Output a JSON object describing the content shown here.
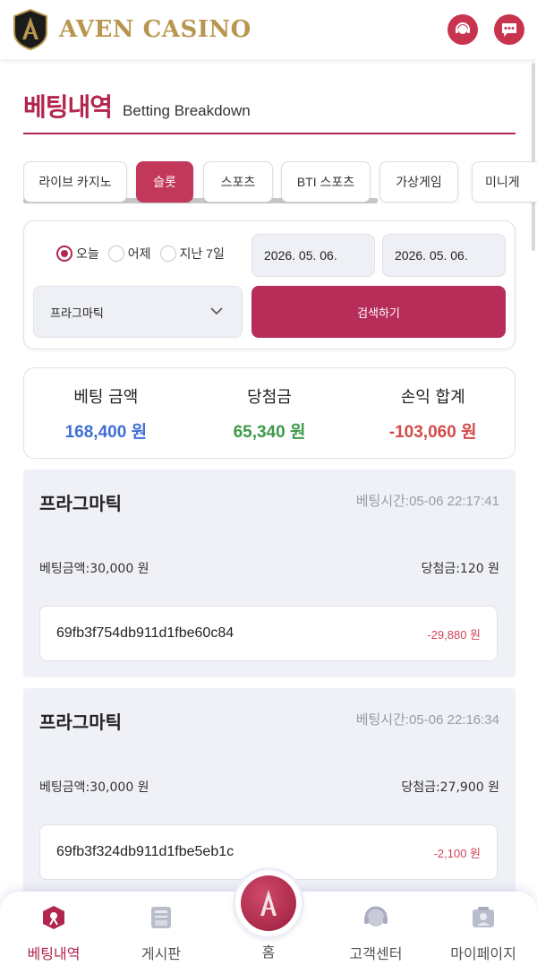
{
  "header": {
    "brand": "AVEN CASINO",
    "icons": [
      "aven-logo-icon",
      "support-agent-icon",
      "chat-bubble-icon"
    ],
    "accent": "#c8344d",
    "brand_color": "#b8964f"
  },
  "page": {
    "title": "베팅내역",
    "subtitle": "Betting Breakdown"
  },
  "tabs": [
    {
      "label": "라이브 카지노",
      "active": false
    },
    {
      "label": "슬롯",
      "active": true
    },
    {
      "label": "스포츠",
      "active": false
    },
    {
      "label": "BTI 스포츠",
      "active": false
    },
    {
      "label": "가상게임",
      "active": false
    },
    {
      "label": "미니게",
      "active": false
    }
  ],
  "filter": {
    "radios": [
      {
        "label": "오늘",
        "checked": true
      },
      {
        "label": "어제",
        "checked": false
      },
      {
        "label": "지난 7일",
        "checked": false
      }
    ],
    "date_from": "2026. 05. 06.",
    "date_to": "2026. 05. 06.",
    "provider": "프라그마틱",
    "search_label": "검색하기"
  },
  "summary": {
    "bet_label": "베팅 금액",
    "bet_value": "168,400 원",
    "win_label": "당첨금",
    "win_value": "65,340 원",
    "pl_label": "손익 합계",
    "pl_value": "-103,060 원",
    "colors": {
      "bet": "#3f6fd6",
      "win": "#3d9a4a",
      "pl": "#d34a4a"
    }
  },
  "records": [
    {
      "provider": "프라그마틱",
      "time": "베팅시간:05-06 22:17:41",
      "bet": "베팅금액:30,000 원",
      "win": "당첨금:120 원",
      "id": "69fb3f754db911d1fbe60c84",
      "pl": "-29,880 원"
    },
    {
      "provider": "프라그마틱",
      "time": "베팅시간:05-06 22:16:34",
      "bet": "베팅금액:30,000 원",
      "win": "당첨금:27,900 원",
      "id": "69fb3f324db911d1fbe5eb1c",
      "pl": "-2,100 원"
    }
  ],
  "nav": {
    "betting": "베팅내역",
    "board": "게시판",
    "home": "홈",
    "support": "고객센터",
    "mypage": "마이페이지"
  }
}
